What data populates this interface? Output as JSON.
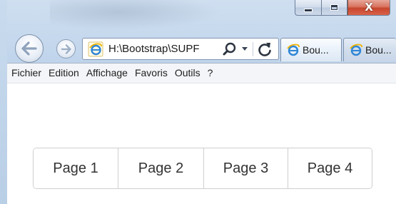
{
  "window": {
    "caption": {
      "minimize_icon": "minimize-icon",
      "maximize_icon": "maximize-icon",
      "close_glyph": "X"
    },
    "colors": {
      "frame": "#bdd2ea",
      "close_button": "#c7452d",
      "menubar": "#f3f5f8"
    }
  },
  "navigation": {
    "back_icon": "back-arrow-icon",
    "forward_icon": "forward-arrow-icon"
  },
  "address_bar": {
    "url": "H:\\Bootstrap\\SUPF",
    "search_icon": "search-icon",
    "refresh_icon": "refresh-icon"
  },
  "tabs": [
    {
      "title": "Bou...",
      "icon": "ie-icon",
      "active": true
    },
    {
      "title": "Bou...",
      "icon": "ie-icon",
      "active": false
    }
  ],
  "menu": [
    "Fichier",
    "Edition",
    "Affichage",
    "Favoris",
    "Outils",
    "?"
  ],
  "pagination": {
    "pages": [
      "Page 1",
      "Page 2",
      "Page 3",
      "Page 4"
    ],
    "text_color": "#333333",
    "border_color": "#cfcfcf"
  }
}
